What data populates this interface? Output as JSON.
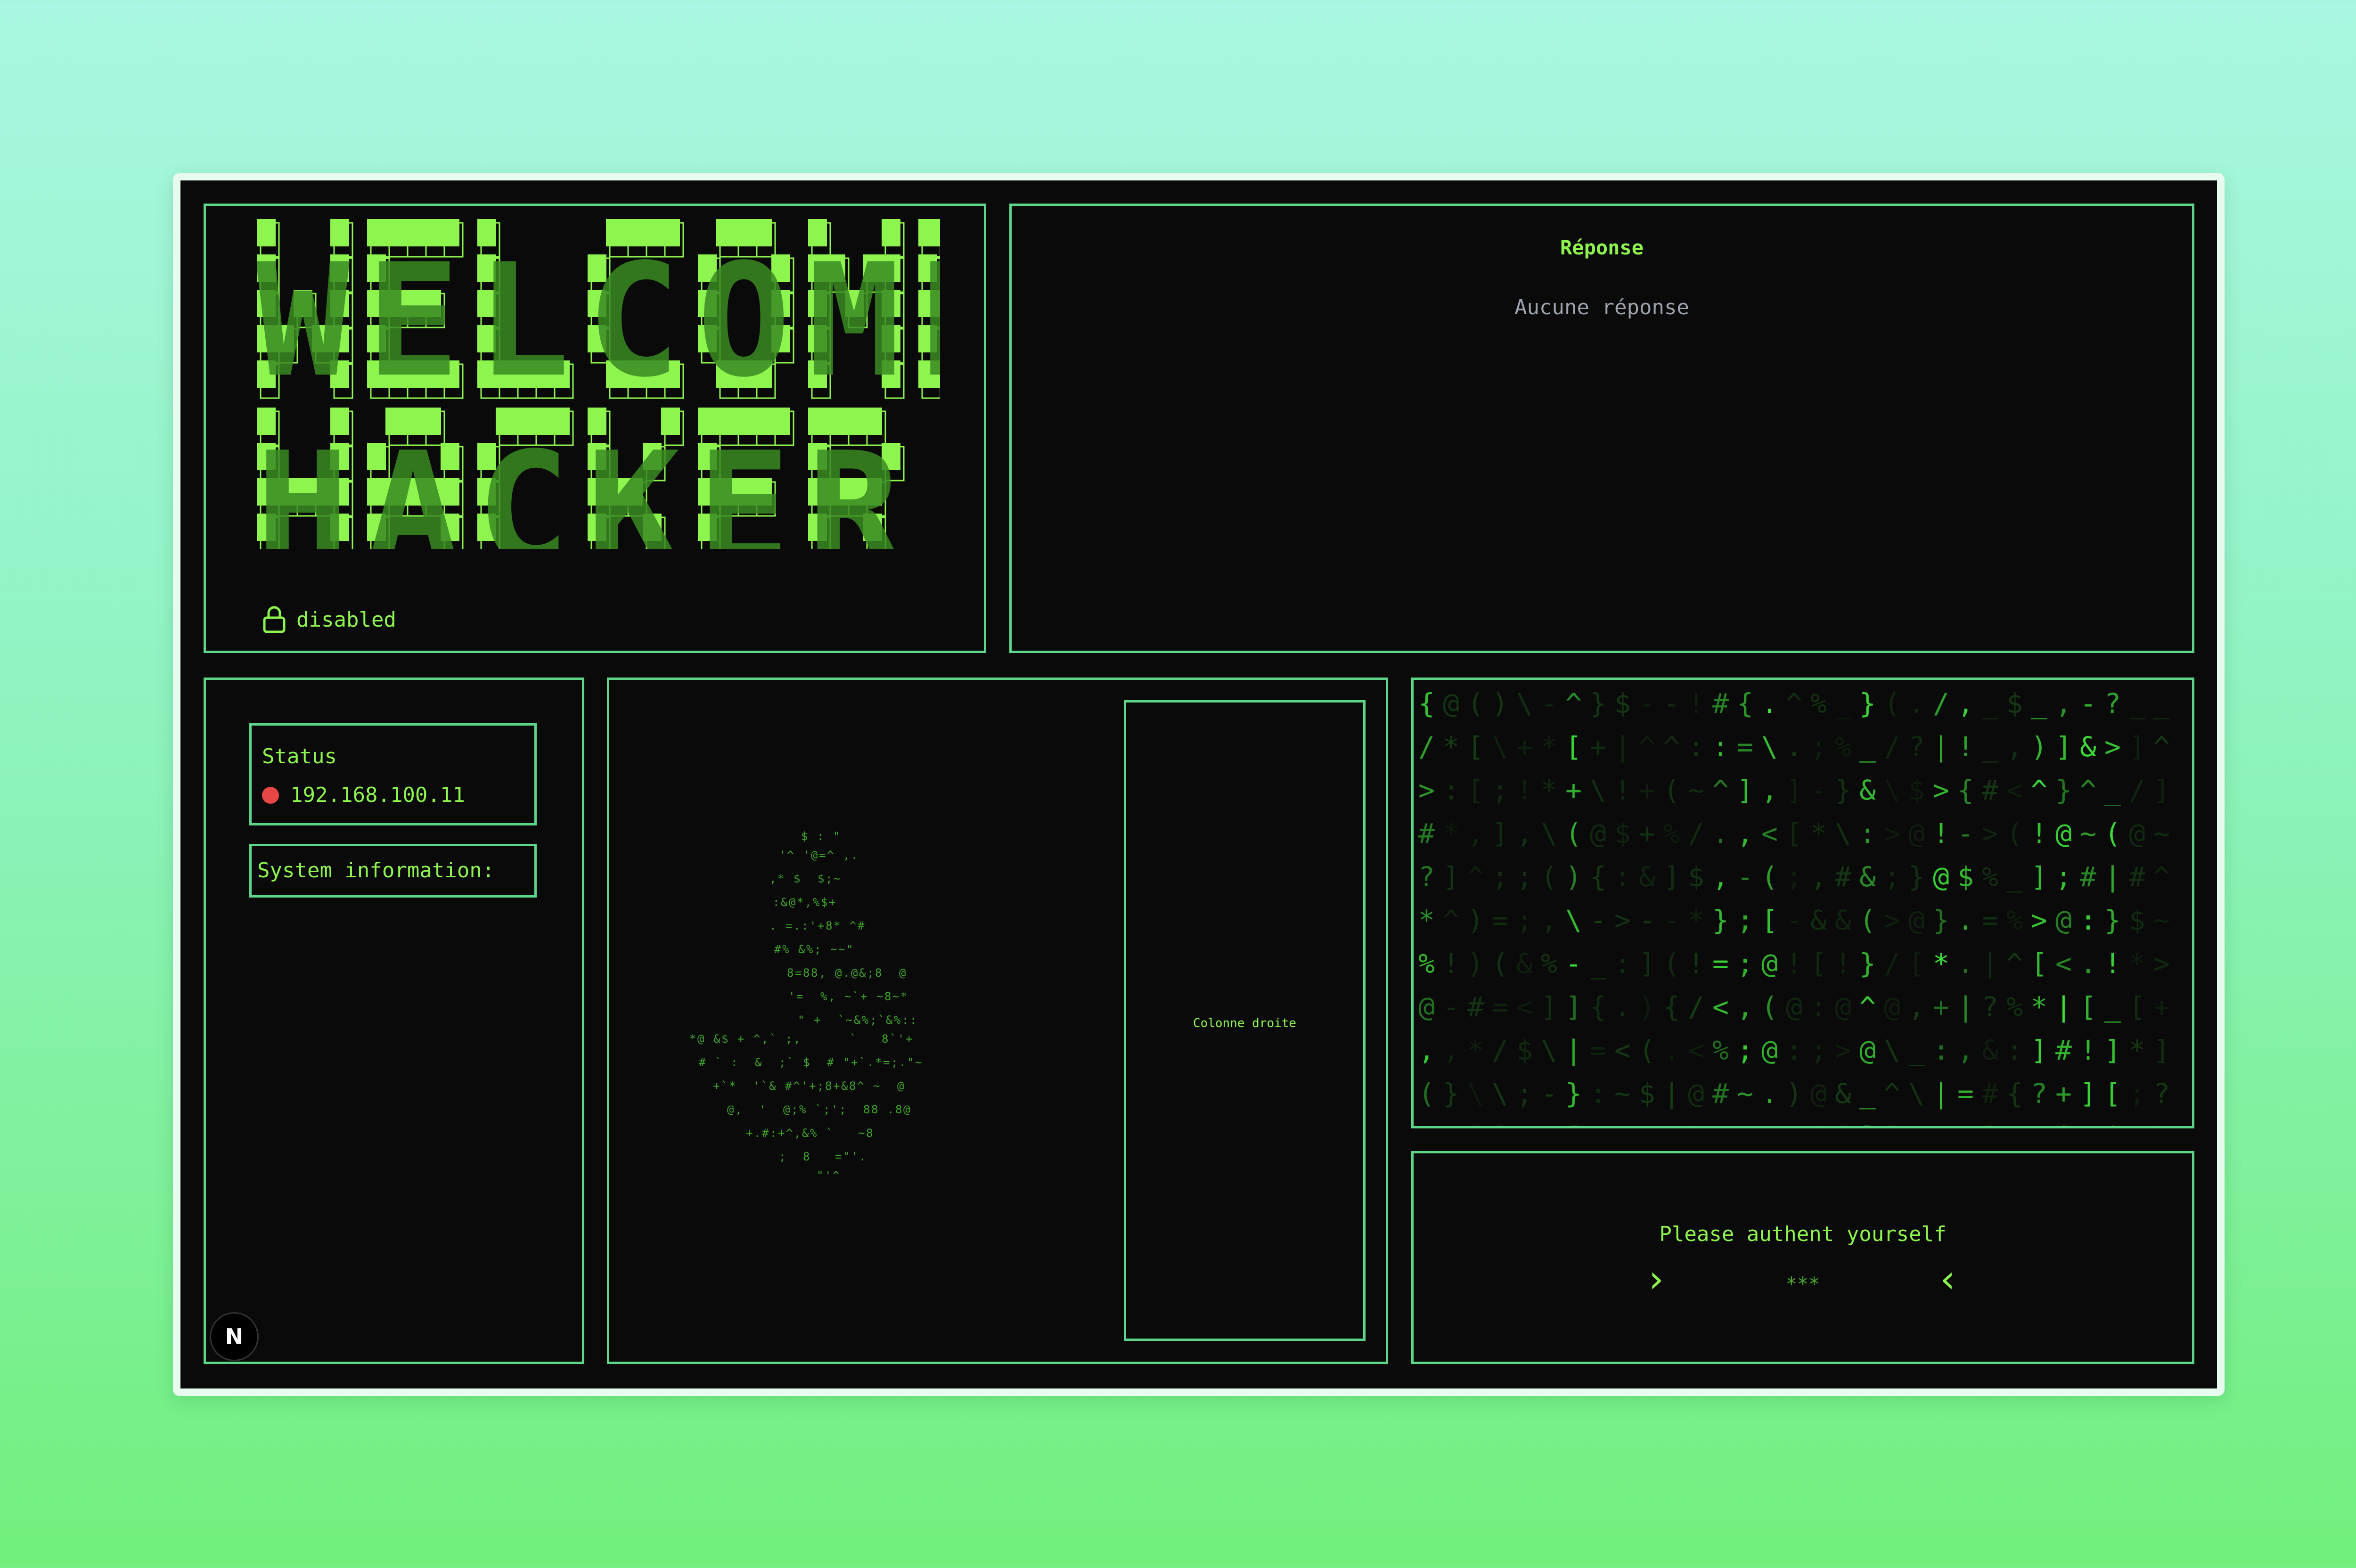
{
  "banner": {
    "line1": "WELCOME",
    "line2": "HACKER"
  },
  "lock": {
    "icon": "lock-icon",
    "label": "disabled"
  },
  "response": {
    "title": "Réponse",
    "empty_text": "Aucune réponse"
  },
  "status": {
    "title": "Status",
    "indicator_color": "#e64646",
    "ip": "192.168.100.11"
  },
  "system_info": {
    "label": "System information:"
  },
  "center": {
    "right_column_label": "Colonne droite"
  },
  "auth": {
    "prompt": "Please authent yourself",
    "input_value": "***",
    "left_chevron": "›",
    "right_chevron": "‹"
  },
  "colors": {
    "accent": "#8ef54f",
    "border": "#5dd68a",
    "background": "#0a0a0a",
    "muted_text": "#9ca3af"
  },
  "badge": {
    "letter": "N"
  }
}
